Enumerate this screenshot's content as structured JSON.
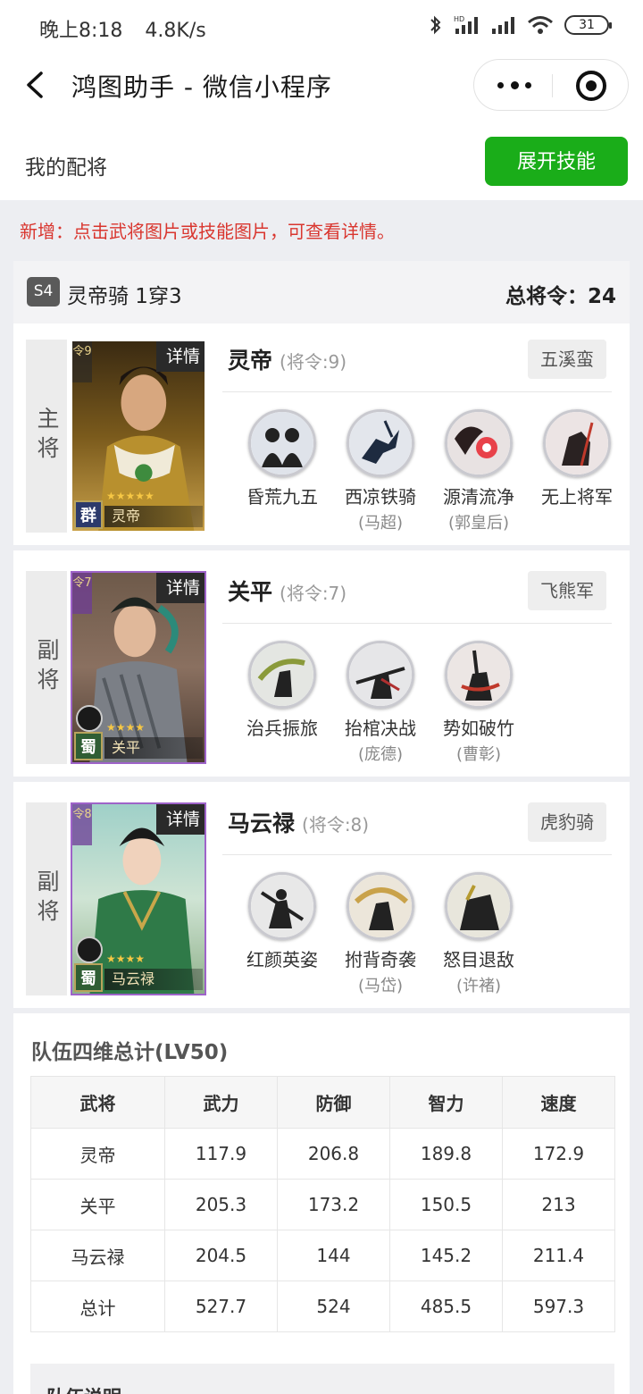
{
  "status_bar": {
    "time": "晚上8:18",
    "net_speed": "4.8K/s",
    "battery": "31",
    "icons": [
      "bluetooth-icon",
      "hd-signal-icon",
      "signal-icon",
      "wifi-icon",
      "battery-icon"
    ]
  },
  "nav": {
    "title": "鸿图助手 - 微信小程序",
    "icons": [
      "back-icon",
      "more-icon",
      "close-miniprogram-icon"
    ]
  },
  "header": {
    "title": "我的配将",
    "expand_button": "展开技能",
    "accent_color": "#1aad19"
  },
  "notice": "新增：点击武将图片或技能图片，可查看详情。",
  "team": {
    "season": "S4",
    "name": "灵帝骑 1穿3",
    "total_command": "总将令：24",
    "generals": [
      {
        "role": "主将",
        "name": "灵帝",
        "command": "(将令:9)",
        "army": "五溪蛮",
        "detail": "详情",
        "card_cmd": "令9",
        "faction": "群",
        "stars": "★★★★★",
        "card_name": "灵帝",
        "skills": [
          {
            "name": "昏荒九五",
            "source": ""
          },
          {
            "name": "西凉铁骑",
            "source": "(马超)"
          },
          {
            "name": "源清流净",
            "source": "(郭皇后)"
          },
          {
            "name": "无上将军",
            "source": ""
          }
        ]
      },
      {
        "role": "副将",
        "name": "关平",
        "command": "(将令:7)",
        "army": "飞熊军",
        "detail": "详情",
        "card_cmd": "令7",
        "faction": "蜀",
        "stars": "★★★★",
        "card_name": "关平",
        "skills": [
          {
            "name": "治兵振旅",
            "source": ""
          },
          {
            "name": "抬棺决战",
            "source": "(庞德)"
          },
          {
            "name": "势如破竹",
            "source": "(曹彰)"
          }
        ]
      },
      {
        "role": "副将",
        "name": "马云禄",
        "command": "(将令:8)",
        "army": "虎豹骑",
        "detail": "详情",
        "card_cmd": "令8",
        "faction": "蜀",
        "stars": "★★★★",
        "card_name": "马云禄",
        "skills": [
          {
            "name": "红颜英姿",
            "source": ""
          },
          {
            "name": "拊背奇袭",
            "source": "(马岱)"
          },
          {
            "name": "怒目退敌",
            "source": "(许褚)"
          }
        ]
      }
    ]
  },
  "stats": {
    "title": "队伍四维总计(LV50)",
    "headers": [
      "武将",
      "武力",
      "防御",
      "智力",
      "速度"
    ],
    "rows": [
      [
        "灵帝",
        "117.9",
        "206.8",
        "189.8",
        "172.9"
      ],
      [
        "关平",
        "205.3",
        "173.2",
        "150.5",
        "213"
      ],
      [
        "马云禄",
        "204.5",
        "144",
        "145.2",
        "211.4"
      ],
      [
        "总计",
        "527.7",
        "524",
        "485.5",
        "597.3"
      ]
    ]
  },
  "description": {
    "title": "队伍说明"
  }
}
